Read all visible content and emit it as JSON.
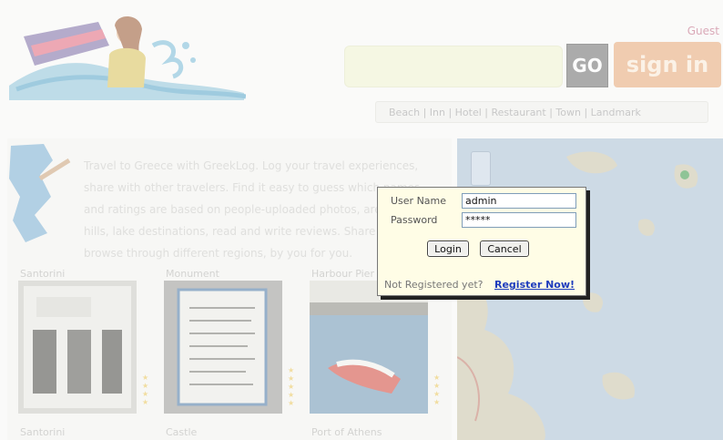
{
  "header": {
    "user_status": "Guest",
    "go_label": "GO",
    "sign_in_label": "sign in",
    "categories_text": "Beach | Inn | Hotel | Restaurant | Town | Landmark"
  },
  "intro": {
    "text": "Travel to Greece with GreekLog. Log your travel experiences, share with other travelers. Find it easy to guess which names and ratings are based on people-uploaded photos, areas, rivers, hills, lake destinations, read and write reviews. Share and browse through different regions, by you for you."
  },
  "thumbnails": [
    {
      "title": "Santorini"
    },
    {
      "title": "Monument"
    },
    {
      "title": "Harbour Pier"
    }
  ],
  "bottom_titles": [
    "Santorini",
    "Castle",
    "Port of Athens"
  ],
  "login_dialog": {
    "username_label": "User Name",
    "username_value": "admin",
    "password_label": "Password",
    "password_value": "*****",
    "login_label": "Login",
    "cancel_label": "Cancel",
    "register_prompt": "Not Registered yet?",
    "register_link": "Register Now!"
  },
  "colors": {
    "sign_in": "#e5a877",
    "go_button": "#6e6e6e",
    "dialog_bg": "#fffde6",
    "register_link": "#1e3cbd"
  },
  "icons": [
    "logo-surfer",
    "greece-map-icon",
    "map-zoom-control"
  ]
}
